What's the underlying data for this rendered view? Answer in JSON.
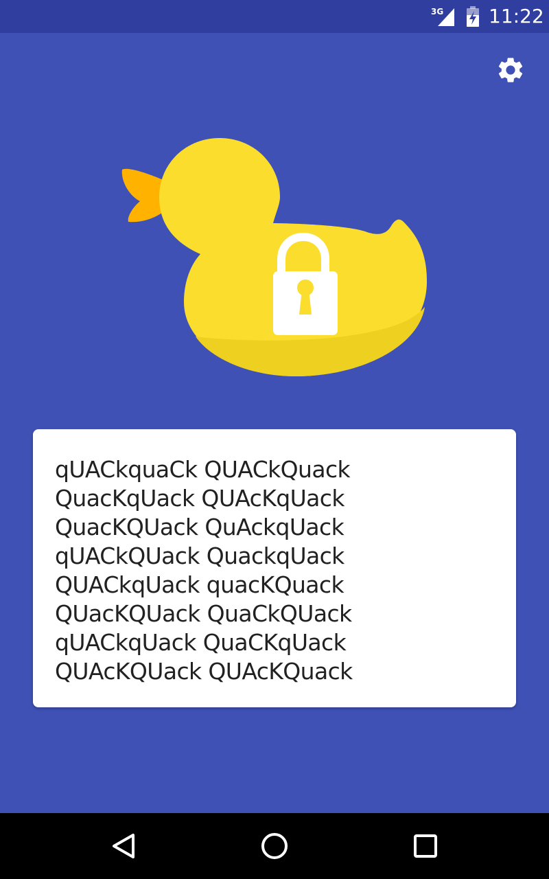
{
  "status_bar": {
    "network": "3G",
    "time": "11:22",
    "icons": [
      "signal-icon",
      "battery-icon"
    ]
  },
  "toolbar": {
    "settings_icon": "gear-icon"
  },
  "logo": {
    "icon": "duck-lock-icon",
    "colors": {
      "body": "#FBDD2E",
      "body_shade": "#EED020",
      "beak": "#FFB300",
      "lock": "#FFFFFF"
    }
  },
  "passphrase": {
    "lines": [
      "qUACkquaCk QUACkQuack",
      "QuacKqUack QUAcKqUack",
      "QuacKQUack QuAckqUack",
      "qUACkQUack QuackqUack",
      "QUACkqUack quacKQuack",
      "QUacKQUack QuaCkQUack",
      "qUACkqUack QuaCKqUack",
      "QUAcKQUack QUAcKQuack"
    ]
  },
  "nav_bar": {
    "icons": [
      "back-icon",
      "home-icon",
      "recents-icon"
    ]
  },
  "colors": {
    "background": "#3F51B5",
    "status_bar": "#303F9F",
    "card": "#FFFFFF",
    "text": "#212121"
  }
}
